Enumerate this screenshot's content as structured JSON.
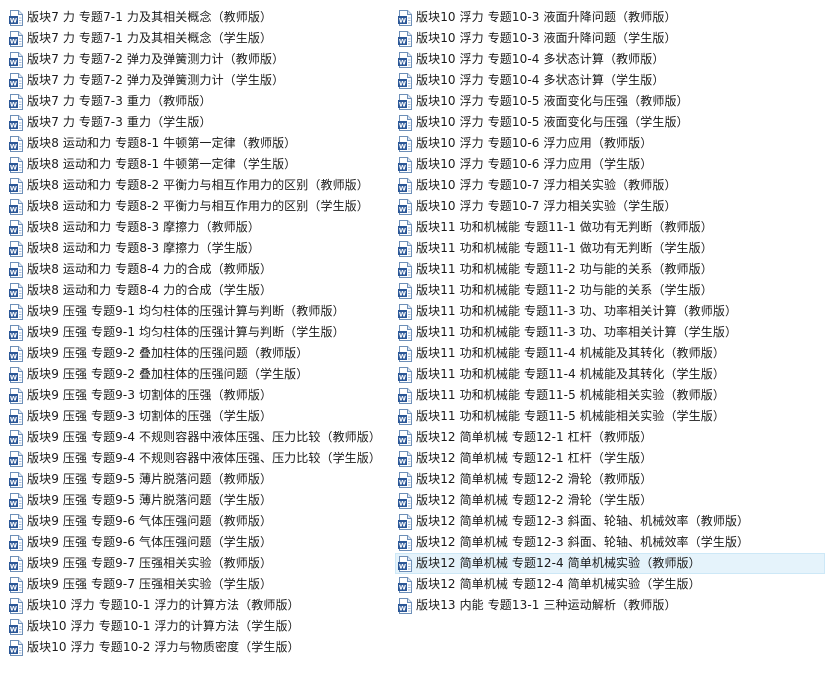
{
  "explorer": {
    "selected": "版块12 简单机械 专题12-4 简单机械实验（教师版）",
    "left_column": [
      "版块7 力 专题7-1 力及其相关概念（教师版）",
      "版块7 力 专题7-1 力及其相关概念（学生版）",
      "版块7 力 专题7-2 弹力及弹簧测力计（教师版）",
      "版块7 力 专题7-2 弹力及弹簧测力计（学生版）",
      "版块7 力 专题7-3 重力（教师版）",
      "版块7 力 专题7-3 重力（学生版）",
      "版块8 运动和力 专题8-1 牛顿第一定律（教师版）",
      "版块8 运动和力 专题8-1 牛顿第一定律（学生版）",
      "版块8 运动和力 专题8-2 平衡力与相互作用力的区别（教师版）",
      "版块8 运动和力 专题8-2 平衡力与相互作用力的区别（学生版）",
      "版块8 运动和力 专题8-3 摩擦力（教师版）",
      "版块8 运动和力 专题8-3 摩擦力（学生版）",
      "版块8 运动和力 专题8-4 力的合成（教师版）",
      "版块8 运动和力 专题8-4 力的合成（学生版）",
      "版块9 压强 专题9-1 均匀柱体的压强计算与判断（教师版）",
      "版块9 压强 专题9-1 均匀柱体的压强计算与判断（学生版）",
      "版块9 压强 专题9-2 叠加柱体的压强问题（教师版）",
      "版块9 压强 专题9-2 叠加柱体的压强问题（学生版）",
      "版块9 压强 专题9-3 切割体的压强（教师版）",
      "版块9 压强 专题9-3 切割体的压强（学生版）",
      "版块9 压强 专题9-4 不规则容器中液体压强、压力比较（教师版）",
      "版块9 压强 专题9-4 不规则容器中液体压强、压力比较（学生版）",
      "版块9 压强 专题9-5 薄片脱落问题（教师版）",
      "版块9 压强 专题9-5 薄片脱落问题（学生版）",
      "版块9 压强 专题9-6 气体压强问题（教师版）",
      "版块9 压强 专题9-6 气体压强问题（学生版）",
      "版块9 压强 专题9-7 压强相关实验（教师版）",
      "版块9 压强 专题9-7 压强相关实验（学生版）",
      "版块10 浮力 专题10-1 浮力的计算方法（教师版）",
      "版块10 浮力 专题10-1 浮力的计算方法（学生版）",
      "版块10 浮力 专题10-2 浮力与物质密度（学生版）"
    ],
    "right_column": [
      "版块10 浮力 专题10-3 液面升降问题（教师版）",
      "版块10 浮力 专题10-3 液面升降问题（学生版）",
      "版块10 浮力 专题10-4 多状态计算（教师版）",
      "版块10 浮力 专题10-4 多状态计算（学生版）",
      "版块10 浮力 专题10-5 液面变化与压强（教师版）",
      "版块10 浮力 专题10-5 液面变化与压强（学生版）",
      "版块10 浮力 专题10-6 浮力应用（教师版）",
      "版块10 浮力 专题10-6 浮力应用（学生版）",
      "版块10 浮力 专题10-7 浮力相关实验（教师版）",
      "版块10 浮力 专题10-7 浮力相关实验（学生版）",
      "版块11 功和机械能 专题11-1 做功有无判断（教师版）",
      "版块11 功和机械能 专题11-1 做功有无判断（学生版）",
      "版块11 功和机械能 专题11-2 功与能的关系（教师版）",
      "版块11 功和机械能 专题11-2 功与能的关系（学生版）",
      "版块11 功和机械能 专题11-3 功、功率相关计算（教师版）",
      "版块11 功和机械能 专题11-3 功、功率相关计算（学生版）",
      "版块11 功和机械能 专题11-4 机械能及其转化（教师版）",
      "版块11 功和机械能 专题11-4 机械能及其转化（学生版）",
      "版块11 功和机械能 专题11-5 机械能相关实验（教师版）",
      "版块11 功和机械能 专题11-5 机械能相关实验（学生版）",
      "版块12 简单机械 专题12-1 杠杆（教师版）",
      "版块12 简单机械 专题12-1 杠杆（学生版）",
      "版块12 简单机械 专题12-2 滑轮（教师版）",
      "版块12 简单机械 专题12-2 滑轮（学生版）",
      "版块12 简单机械 专题12-3 斜面、轮轴、机械效率（教师版）",
      "版块12 简单机械 专题12-3 斜面、轮轴、机械效率（学生版）",
      "版块12 简单机械 专题12-4 简单机械实验（教师版）",
      "版块12 简单机械 专题12-4 简单机械实验（学生版）",
      "版块13 内能 专题13-1 三种运动解析（教师版）"
    ],
    "icon": "word-document-icon",
    "colors": {
      "icon_blue": "#2b5797",
      "icon_border": "#6d8fb8",
      "selection_bg": "#e5f3fb",
      "selection_border": "#cde8f7"
    }
  }
}
